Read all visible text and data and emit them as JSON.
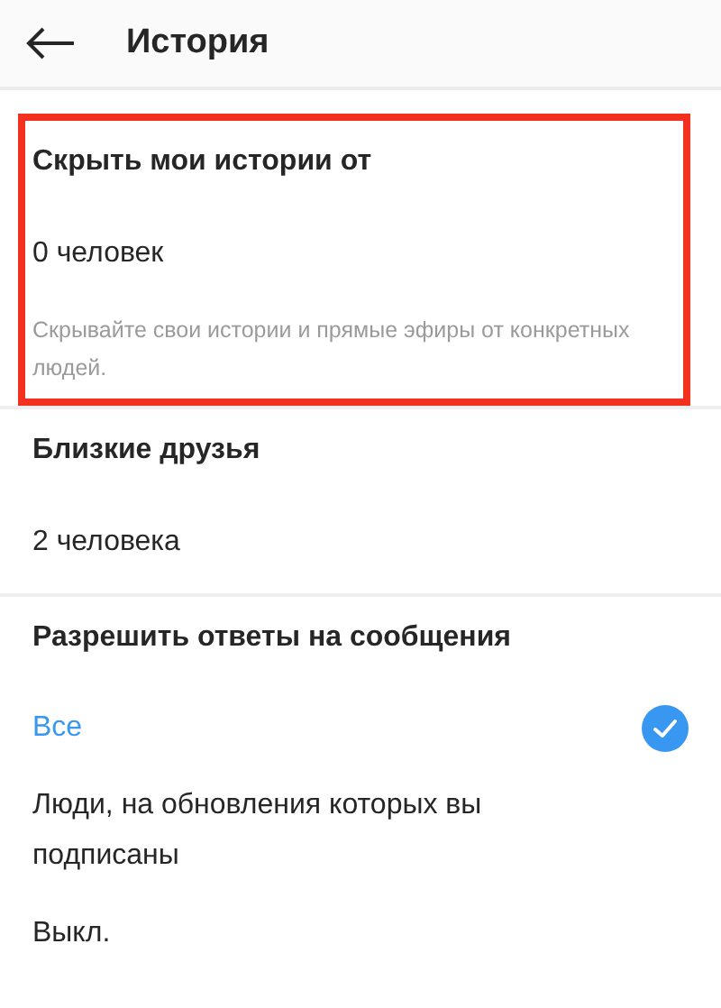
{
  "header": {
    "title": "История"
  },
  "sections": [
    {
      "title": "Скрыть мои истории от",
      "highlighted": true,
      "value": "0 человек",
      "hint": "Скрывайте свои истории и прямые эфиры от конкретных людей."
    },
    {
      "title": "Близкие друзья",
      "highlighted": false,
      "value": "2 человека"
    },
    {
      "title": "Разрешить ответы на сообщения",
      "highlighted": false,
      "options": [
        {
          "label": "Все",
          "selected": true
        },
        {
          "label": "Люди, на обновления которых вы подписаны",
          "selected": false
        },
        {
          "label": "Выкл.",
          "selected": false
        }
      ]
    }
  ]
}
